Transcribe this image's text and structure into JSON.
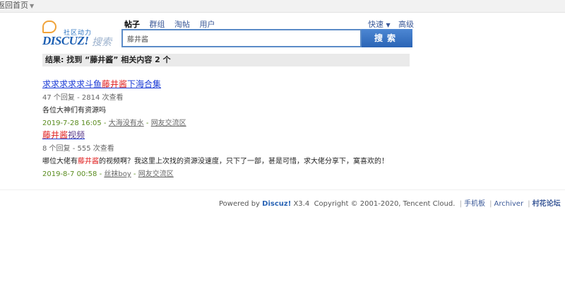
{
  "topbar": {
    "home_label": "返回首页"
  },
  "logo": {
    "slogan": "社区动力",
    "brand": "DISCUZ!",
    "search_text": "搜索"
  },
  "search": {
    "tabs": [
      {
        "label": "帖子",
        "active": true
      },
      {
        "label": "群组",
        "active": false
      },
      {
        "label": "淘帖",
        "active": false
      },
      {
        "label": "用户",
        "active": false
      }
    ],
    "quick_label": "快速",
    "advanced_label": "高级",
    "query": "藤井酱",
    "button_label": "搜索"
  },
  "result_summary": "结果: 找到 “藤井酱” 相关内容 2 个",
  "results": [
    {
      "title_pre": "求求求求求斗鱼",
      "title_hl": "藤井酱",
      "title_post": "下海合集",
      "stats": "47 个回复 - 2814 次查看",
      "snippet_pre": "各位大神们有资源吗",
      "snippet_hl": "",
      "snippet_post": "",
      "date": "2019-7-28 16:05",
      "author": "大海没有水",
      "forum": "网友交流区"
    },
    {
      "title_pre": "",
      "title_hl": "藤井酱",
      "title_post": "视频",
      "stats": "8 个回复 - 555 次查看",
      "snippet_pre": "哪位大佬有",
      "snippet_hl": "藤井酱",
      "snippet_post": "的视频啊？我这里上次找的资源没速度，只下了一部，甚是可惜，求大佬分享下，寞喜欢的！",
      "date": "2019-8-7 00:58",
      "author": "丝袜boy",
      "forum": "网友交流区"
    }
  ],
  "footer": {
    "powered": "Powered by",
    "brand": "Discuz!",
    "version": "X3.4",
    "copyright": "Copyright © 2001-2020, Tencent Cloud.",
    "links": [
      "手机板",
      "Archiver"
    ],
    "site_name": "村花论坛"
  }
}
